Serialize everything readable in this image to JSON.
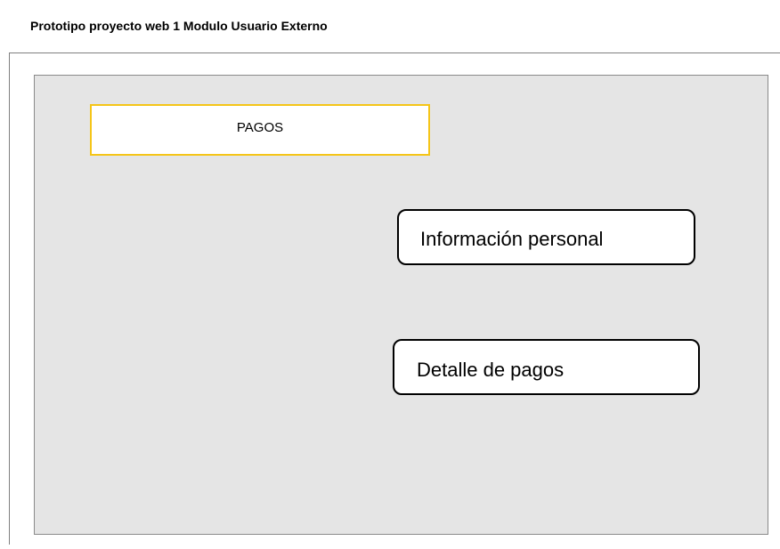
{
  "header": {
    "title": "Prototipo proyecto web 1 Modulo Usuario Externo"
  },
  "main": {
    "section_label": "PAGOS",
    "buttons": {
      "personal_info": "Información personal",
      "payment_details": "Detalle de pagos"
    }
  },
  "colors": {
    "canvas_background": "#e5e5e5",
    "section_border": "#f5c518",
    "button_border": "#000000"
  }
}
